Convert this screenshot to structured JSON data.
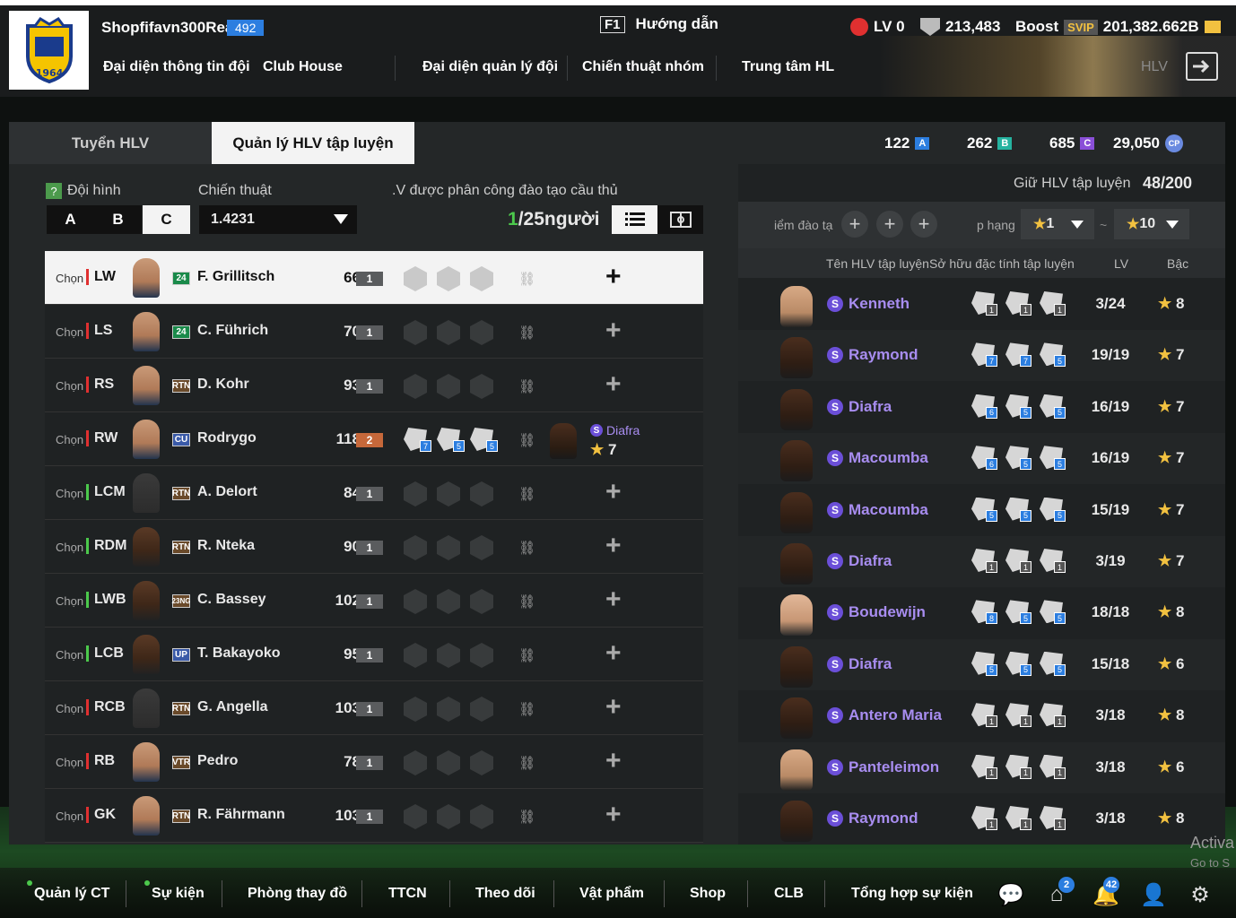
{
  "header": {
    "username": "Shopfifavn300Rea",
    "user_level": "492",
    "guide_key": "F1",
    "guide_label": "Hướng dẫn",
    "lv_label": "LV 0",
    "currency_1": "213,483",
    "boost_label": "Boost",
    "svip_label": "SVIP",
    "currency_2": "201,382.662B",
    "hlv_label": "HLV",
    "logo_year": "1964",
    "nav": [
      "Đại diện thông tin đội",
      "Club House",
      "Đại diện quản lý đội",
      "Chiến thuật nhóm",
      "Trung tâm HL"
    ]
  },
  "tabs": {
    "recruit": "Tuyển HLV",
    "manage": "Quản lý HLV tập luyện"
  },
  "points": {
    "a_value": "122",
    "a_label": "A",
    "b_value": "262",
    "b_label": "B",
    "c_value": "685",
    "c_label": "C",
    "cp_value": "29,050",
    "cp_label": "CP"
  },
  "left": {
    "help_icon_label": "?",
    "formation_label": "Đội hình",
    "tactic_label": "Chiến thuật",
    "assigned_label": ".V được phân công đào tạo cầu thủ",
    "squad_a": "A",
    "squad_b": "B",
    "squad_c": "C",
    "tactic_value": "1.4231",
    "count_current": "1",
    "count_rest": "/25người"
  },
  "players": [
    {
      "choose": "Chọn",
      "pos": "LW",
      "season": "24",
      "name": "F. Grillitsch",
      "ovr": "66",
      "lvl": "1"
    },
    {
      "choose": "Chọn",
      "pos": "LS",
      "season": "24",
      "name": "C. Führich",
      "ovr": "70",
      "lvl": "1"
    },
    {
      "choose": "Chọn",
      "pos": "RS",
      "season": "RTN",
      "name": "D. Kohr",
      "ovr": "93",
      "lvl": "1"
    },
    {
      "choose": "Chọn",
      "pos": "RW",
      "season": "CU",
      "name": "Rodrygo",
      "ovr": "118",
      "lvl": "2",
      "traits": [
        "7",
        "5",
        "5"
      ],
      "coach_name": "Diafra",
      "coach_star": "7"
    },
    {
      "choose": "Chọn",
      "pos": "LCM",
      "season": "RTN",
      "name": "A. Delort",
      "ovr": "84",
      "lvl": "1"
    },
    {
      "choose": "Chọn",
      "pos": "RDM",
      "season": "RTN",
      "name": "R. Nteka",
      "ovr": "90",
      "lvl": "1"
    },
    {
      "choose": "Chọn",
      "pos": "LWB",
      "season": "23NG",
      "name": "C. Bassey",
      "ovr": "102",
      "lvl": "1"
    },
    {
      "choose": "Chọn",
      "pos": "LCB",
      "season": "UP",
      "name": "T. Bakayoko",
      "ovr": "95",
      "lvl": "1"
    },
    {
      "choose": "Chọn",
      "pos": "RCB",
      "season": "RTN",
      "name": "G. Angella",
      "ovr": "103",
      "lvl": "1"
    },
    {
      "choose": "Chọn",
      "pos": "RB",
      "season": "VTR",
      "name": "Pedro",
      "ovr": "78",
      "lvl": "1"
    },
    {
      "choose": "Chọn",
      "pos": "GK",
      "season": "RTN",
      "name": "R. Fährmann",
      "ovr": "103",
      "lvl": "1"
    }
  ],
  "right": {
    "keep_label": "Giữ HLV tập luyện",
    "keep_value": "48/200",
    "filter_label": "iểm đào tạ",
    "rank_label": "p hạng",
    "rank_min": "1",
    "rank_sep": "~",
    "rank_max": "10",
    "col_name": "Tên HLV tập luyện",
    "col_traits": "Sở hữu đặc tính tập luyện",
    "col_lv": "LV",
    "col_rank": "Bậc"
  },
  "coaches": [
    {
      "name": "Kenneth",
      "traits": [
        "1",
        "1",
        "1"
      ],
      "lv": "3/24",
      "star": "8",
      "face": "asia"
    },
    {
      "name": "Raymond",
      "traits": [
        "7",
        "7",
        "5"
      ],
      "lv": "19/19",
      "star": "7",
      "face": "dark"
    },
    {
      "name": "Diafra",
      "traits": [
        "6",
        "5",
        "5"
      ],
      "lv": "16/19",
      "star": "7",
      "face": "dark"
    },
    {
      "name": "Macoumba",
      "traits": [
        "6",
        "5",
        "5"
      ],
      "lv": "16/19",
      "star": "7",
      "face": "dark"
    },
    {
      "name": "Macoumba",
      "traits": [
        "5",
        "5",
        "5"
      ],
      "lv": "15/19",
      "star": "7",
      "face": "dark"
    },
    {
      "name": "Diafra",
      "traits": [
        "1",
        "1",
        "1"
      ],
      "lv": "3/19",
      "star": "7",
      "face": "dark"
    },
    {
      "name": "Boudewijn",
      "traits": [
        "8",
        "5",
        "5"
      ],
      "lv": "18/18",
      "star": "8",
      "face": "light"
    },
    {
      "name": "Diafra",
      "traits": [
        "5",
        "5",
        "5"
      ],
      "lv": "15/18",
      "star": "6",
      "face": "dark"
    },
    {
      "name": "Antero Maria",
      "traits": [
        "1",
        "1",
        "1"
      ],
      "lv": "3/18",
      "star": "8",
      "face": "dark"
    },
    {
      "name": "Panteleimon",
      "traits": [
        "1",
        "1",
        "1"
      ],
      "lv": "3/18",
      "star": "6",
      "face": "asia"
    },
    {
      "name": "Raymond",
      "traits": [
        "1",
        "1",
        "1"
      ],
      "lv": "3/18",
      "star": "8",
      "face": "dark"
    }
  ],
  "bottom": {
    "nav": [
      "Quản lý CT",
      "Sự kiện",
      "Phòng thay đồ",
      "TTCN",
      "Theo dõi",
      "Vật phẩm",
      "Shop",
      "CLB",
      "Tổng hợp sự kiện"
    ],
    "badge_home": "2",
    "badge_bell": "42"
  },
  "watermark": {
    "line1": "Activa",
    "line2": "Go to S"
  },
  "colors": {
    "accent_blue": "#2c7ee0",
    "trait_purple": "#a88df0",
    "star_gold": "#f2c140",
    "pos_red": "#e03030",
    "pos_green": "#4cc94c"
  }
}
